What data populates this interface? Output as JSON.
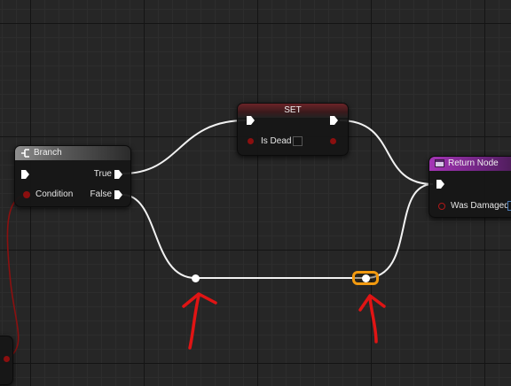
{
  "nodes": {
    "branch": {
      "title": "Branch",
      "icon": "branch-icon",
      "pins": {
        "true_label": "True",
        "false_label": "False",
        "condition_label": "Condition"
      }
    },
    "set": {
      "title": "SET",
      "pins": {
        "is_dead_label": "Is Dead"
      },
      "is_dead_checked": false
    },
    "return_node": {
      "title": "Return Node",
      "icon": "function-icon",
      "pins": {
        "was_damaged_label": "Was Damaged"
      }
    }
  },
  "colors": {
    "exec_wire": "#f2f2f2",
    "bool_wire": "#8b1010",
    "annotation_arrow": "#e01414",
    "reroute_highlight": "#f29a10",
    "branch_header": "#8f8f8f",
    "set_header": "#6b2428",
    "return_header": "#a535b6"
  }
}
